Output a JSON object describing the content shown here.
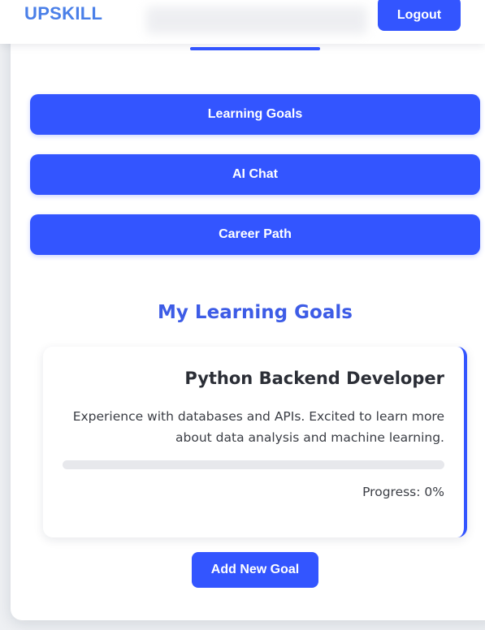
{
  "navbar": {
    "logo": "UPSKILL",
    "logout_label": "Logout"
  },
  "menu": {
    "learning_goals_label": "Learning Goals",
    "ai_chat_label": "AI Chat",
    "career_path_label": "Career Path"
  },
  "goals_section": {
    "title": "My Learning Goals",
    "goals": [
      {
        "title": "Python Backend Developer",
        "description": "Experience with databases and APIs. Excited to learn more about data analysis and machine learning.",
        "progress_percent": 0,
        "progress_text": "Progress: 0%"
      }
    ],
    "add_goal_label": "Add New Goal"
  },
  "colors": {
    "accent": "#3355ff",
    "logo": "#4a7fe8",
    "section_title": "#3d5ce6"
  }
}
